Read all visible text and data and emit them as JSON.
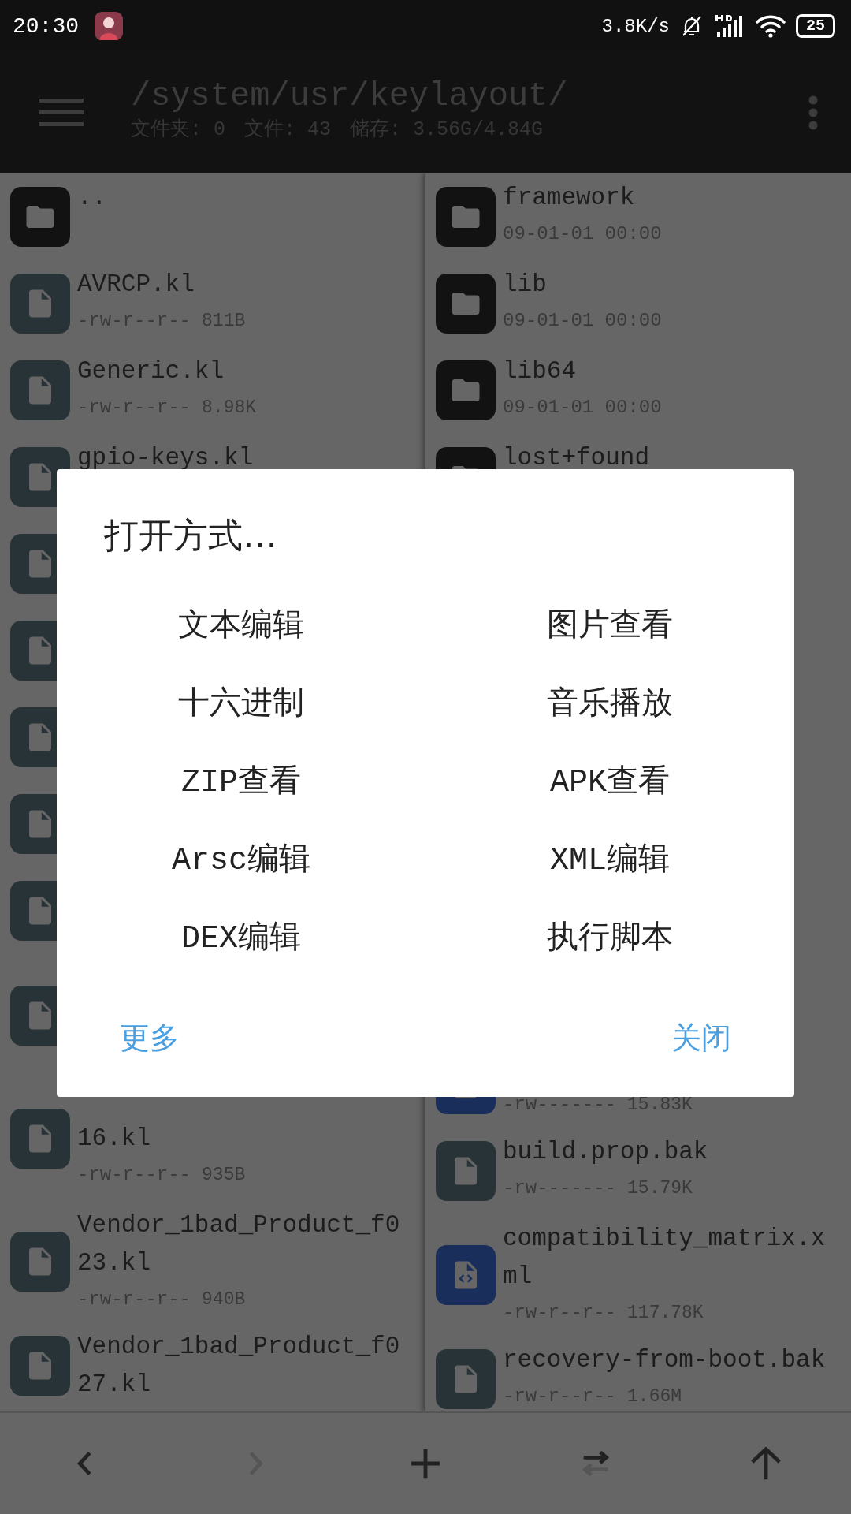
{
  "status_bar": {
    "time": "20:30",
    "speed": "3.8K/s",
    "battery": "25"
  },
  "header": {
    "path": "/system/usr/keylayout/",
    "stats": [
      "文件夹: 0",
      "文件: 43",
      "储存: 3.56G/4.84G"
    ]
  },
  "left_pane": [
    {
      "kind": "folder",
      "name": ".."
    },
    {
      "kind": "file",
      "name": "AVRCP.kl",
      "perms": "-rw-r--r--",
      "size": "811B"
    },
    {
      "kind": "file",
      "name": "Generic.kl",
      "perms": "-rw-r--r--",
      "size": "8.98K"
    },
    {
      "kind": "file",
      "name": "gpio-keys.kl"
    },
    {
      "kind": "file"
    },
    {
      "kind": "file"
    },
    {
      "kind": "file"
    },
    {
      "kind": "file"
    },
    {
      "kind": "file"
    },
    {
      "kind": "file-long"
    },
    {
      "kind": "file-wrapped",
      "name": "16.kl",
      "perms": "-rw-r--r--",
      "size": "935B"
    },
    {
      "kind": "file",
      "name": "Vendor_1bad_Product_f023.kl",
      "perms": "-rw-r--r--",
      "size": "940B"
    },
    {
      "kind": "file",
      "name": "Vendor_1bad_Product_f027.kl"
    }
  ],
  "right_pane": [
    {
      "kind": "folder",
      "name": "framework",
      "date": "09-01-01 00:00"
    },
    {
      "kind": "folder",
      "name": "lib",
      "date": "09-01-01 00:00"
    },
    {
      "kind": "folder",
      "name": "lib64",
      "date": "09-01-01 00:00"
    },
    {
      "kind": "folder",
      "name": "lost+found"
    },
    {
      "kind": "covered"
    },
    {
      "kind": "covered"
    },
    {
      "kind": "covered"
    },
    {
      "kind": "covered"
    },
    {
      "kind": "covered"
    },
    {
      "kind": "covered"
    },
    {
      "kind": "xml",
      "perms": "-rw-------",
      "size": "15.83K"
    },
    {
      "kind": "file",
      "name": "build.prop.bak",
      "perms": "-rw-------",
      "size": "15.79K"
    },
    {
      "kind": "xml",
      "name": "compatibility_matrix.xml",
      "perms": "-rw-r--r--",
      "size": "117.78K"
    },
    {
      "kind": "file",
      "name": "recovery-from-boot.bak",
      "perms": "-rw-r--r--",
      "size": "1.66M"
    }
  ],
  "dialog": {
    "title": "打开方式…",
    "options": [
      "文本编辑",
      "图片查看",
      "十六进制",
      "音乐播放",
      "ZIP查看",
      "APK查看",
      "Arsc编辑",
      "XML编辑",
      "DEX编辑",
      "执行脚本"
    ],
    "buttons": [
      "更多",
      "关闭"
    ]
  },
  "bottom_bar": [
    {
      "kind": "back",
      "disabled": false
    },
    {
      "kind": "forward",
      "disabled": true
    },
    {
      "kind": "add",
      "disabled": false
    },
    {
      "kind": "swap",
      "disabled": false
    },
    {
      "kind": "up",
      "disabled": false
    }
  ]
}
